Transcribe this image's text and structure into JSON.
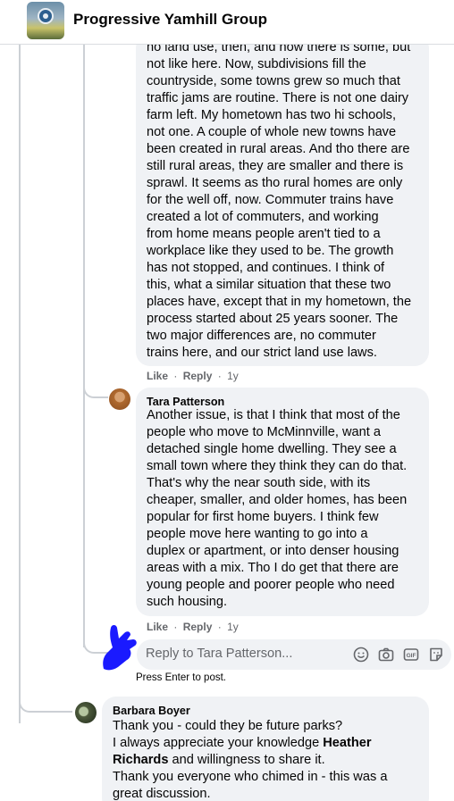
{
  "header": {
    "group_name": "Progressive Yamhill Group"
  },
  "comments": [
    {
      "lines": [
        "no land use, then, and now there is some, but",
        "not like here. Now, subdivisions fill the",
        "countryside, some towns grew so much that",
        "traffic jams are routine. There is not one dairy",
        "farm left. My hometown has two hi schools,",
        "not one. A couple of whole new towns have",
        "been created in rural areas. And tho there are",
        "still rural areas, they are smaller and there is",
        "sprawl. It seems as tho rural homes are only",
        "for the well off, now. Commuter trains have",
        "created a lot of commuters, and working",
        "from home means people aren't tied to a",
        "workplace like they used to be. The growth",
        "has not stopped, and continues. I think of",
        "this, what a similar situation that these two",
        "places have, except that in my hometown, the",
        "process started about 25 years sooner. The",
        "two major differences are, no commuter",
        "trains here, and our strict land use laws."
      ],
      "like": "Like",
      "reply": "Reply",
      "time": "1y"
    },
    {
      "author": "Tara Patterson",
      "lines": [
        "Another issue, is that I think that most of the",
        "people who move to McMinnville, want a",
        "detached single home dwelling. They see a",
        "small town where they think they can do that.",
        "That's why the near south side, with its",
        "cheaper, smaller, and older homes, has been",
        "popular for first home buyers. I think few",
        "people move here wanting to go into a",
        "duplex or apartment, or into denser housing",
        "areas with a mix. Tho I do get that there are",
        "young people and poorer people who need",
        "such housing."
      ],
      "like": "Like",
      "reply": "Reply",
      "time": "1y"
    }
  ],
  "reply_box": {
    "placeholder": "Reply to Tara Patterson...",
    "hint": "Press Enter to post."
  },
  "barbara": {
    "author": "Barbara Boyer",
    "line1": "Thank you - could they be future parks?",
    "line2_pre": "I always appreciate your knowledge ",
    "line2_name": "Heather",
    "line3_name": "Richards",
    "line3_post": " and willingness to share it.",
    "line4": "Thank you everyone who chimed in - this was a",
    "line5": "great discussion."
  },
  "dot": "·"
}
